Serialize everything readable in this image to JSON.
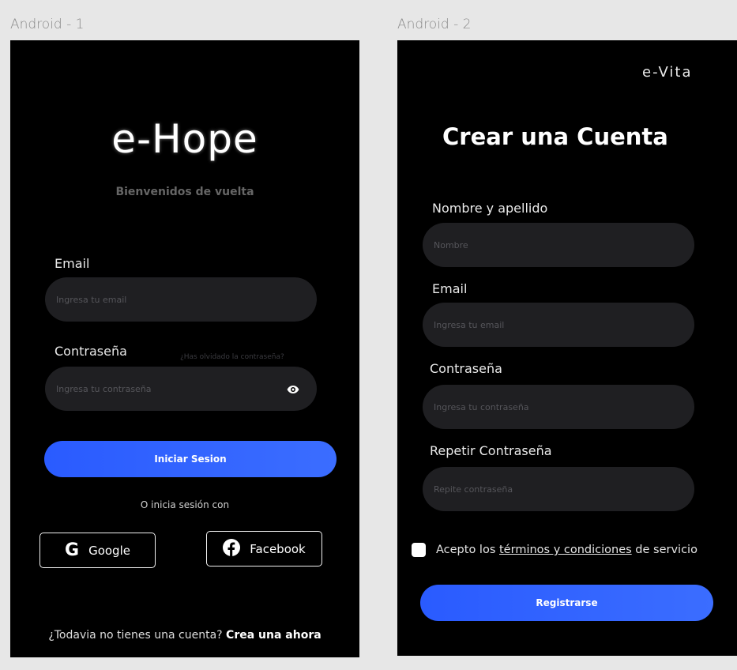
{
  "frames": {
    "login_label": "Android - 1",
    "register_label": "Android - 2"
  },
  "login": {
    "logo": "e-Hope",
    "subtitle": "Bienvenidos de vuelta",
    "email_label": "Email",
    "email_placeholder": "Ingresa tu email",
    "password_label": "Contraseña",
    "forgot_password": "¿Has olvidado la contraseña?",
    "password_placeholder": "Ingresa tu contraseña",
    "login_button": "Iniciar Sesion",
    "or_text": "O inicia sesión con",
    "google_button": "Google",
    "facebook_button": "Facebook",
    "no_account_text": "¿Todavia no tienes una cuenta?",
    "create_account_link": "Crea una ahora"
  },
  "register": {
    "brand": "e-Vita",
    "title": "Crear una Cuenta",
    "name_label": "Nombre y apellido",
    "name_placeholder": "Nombre",
    "email_label": "Email",
    "email_placeholder": "Ingresa tu email",
    "password_label": "Contraseña",
    "password_placeholder": "Ingresa tu contraseña",
    "repeat_label": "Repetir Contraseña",
    "repeat_placeholder": "Repite contraseña",
    "terms_prefix": "Acepto los",
    "terms_link": "términos y condiciones",
    "terms_suffix": "de servicio",
    "register_button": "Registrarse"
  },
  "colors": {
    "primary": "#2a5bff",
    "screen_bg": "#000000",
    "input_bg": "#1f1f22",
    "canvas_bg": "#e7e7e7"
  },
  "icons": [
    "eye-icon",
    "google-icon",
    "facebook-icon",
    "checkbox-icon"
  ]
}
